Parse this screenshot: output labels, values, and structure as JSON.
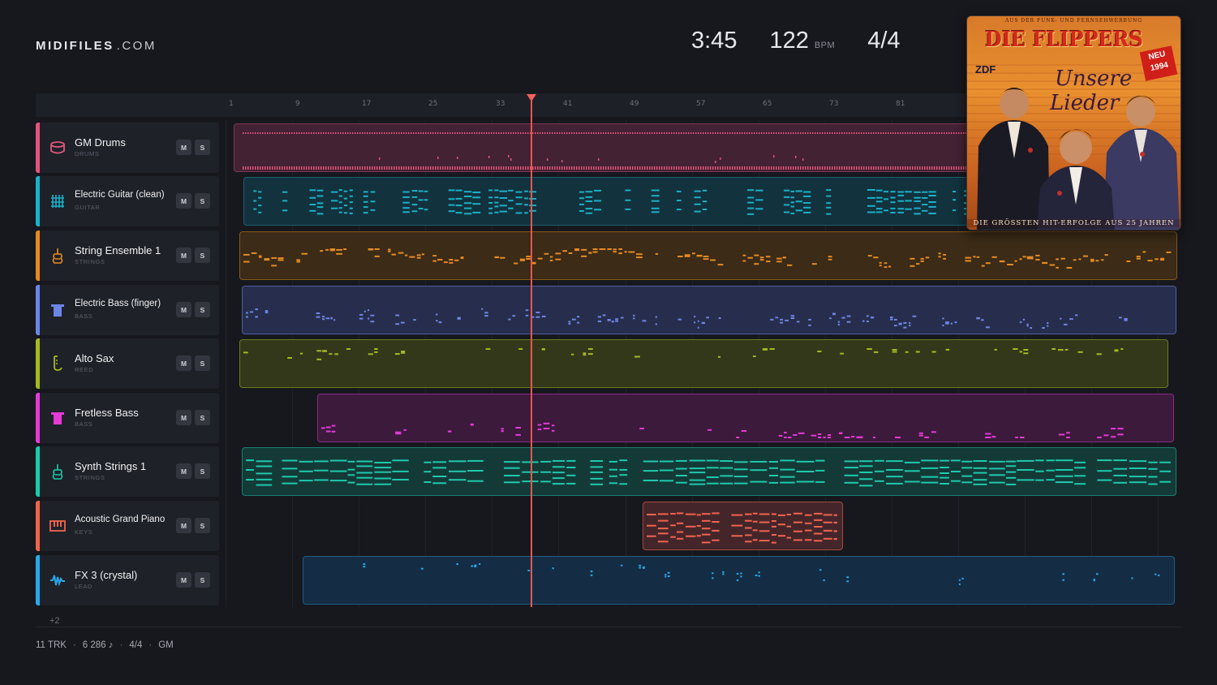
{
  "brand": {
    "name_bold": "MIDIFILES",
    "name_light": ".COM"
  },
  "stats": {
    "duration": "3:45",
    "tempo": "122",
    "tempo_unit": "BPM",
    "time_signature": "4/4"
  },
  "ruler": {
    "bars": [
      "1",
      "9",
      "17",
      "25",
      "33",
      "41",
      "49",
      "57",
      "65",
      "73",
      "81"
    ]
  },
  "tracks": [
    {
      "name": "GM Drums",
      "category": "DRUMS",
      "color": "#e2547c",
      "icon": "drum-icon",
      "mute": "M",
      "solo": "S"
    },
    {
      "name": "Electric Guitar (clean)",
      "category": "GUITAR",
      "color": "#1ab0c8",
      "icon": "guitar-icon",
      "mute": "M",
      "solo": "S"
    },
    {
      "name": "String Ensemble 1",
      "category": "STRINGS",
      "color": "#e68a22",
      "icon": "violin-icon",
      "mute": "M",
      "solo": "S"
    },
    {
      "name": "Electric Bass (finger)",
      "category": "BASS",
      "color": "#6c86e6",
      "icon": "bass-icon",
      "mute": "M",
      "solo": "S"
    },
    {
      "name": "Alto Sax",
      "category": "REED",
      "color": "#a5b922",
      "icon": "sax-icon",
      "mute": "M",
      "solo": "S"
    },
    {
      "name": "Fretless Bass",
      "category": "BASS",
      "color": "#e43ad6",
      "icon": "bass-icon",
      "mute": "M",
      "solo": "S"
    },
    {
      "name": "Synth Strings 1",
      "category": "STRINGS",
      "color": "#1ec9ad",
      "icon": "violin-icon",
      "mute": "M",
      "solo": "S"
    },
    {
      "name": "Acoustic Grand Piano",
      "category": "KEYS",
      "color": "#f0644e",
      "icon": "piano-icon",
      "mute": "M",
      "solo": "S"
    },
    {
      "name": "FX 3 (crystal)",
      "category": "LEAD",
      "color": "#2aa8ea",
      "icon": "wave-icon",
      "mute": "M",
      "solo": "S"
    }
  ],
  "more_tracks": "+2",
  "footer": {
    "tracks": "11 TRK",
    "notes": "6 286 ♪",
    "meter": "4/4",
    "standard": "GM"
  },
  "cover": {
    "top_text": "AUS DER FUNK- UND FERNSEHWERBUNG",
    "artist": "DIE FLIPPERS",
    "badge_neu": "NEU",
    "badge_year": "1994",
    "network": "ZDF",
    "title_line1": "Unsere",
    "title_line2": "Lieder",
    "bottom_text": "DIE GRÖSSTEN HIT-ERFOLGE AUS 25 JAHREN"
  }
}
